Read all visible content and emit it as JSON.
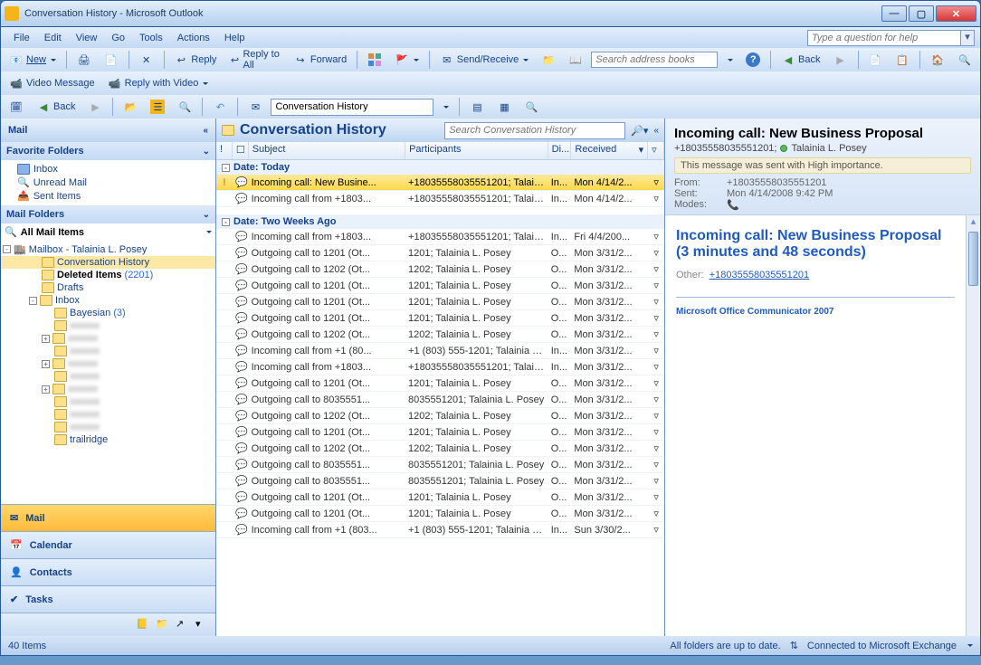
{
  "window": {
    "title": "Conversation History - Microsoft Outlook"
  },
  "menu": [
    "File",
    "Edit",
    "View",
    "Go",
    "Tools",
    "Actions",
    "Help"
  ],
  "ask_placeholder": "Type a question for help",
  "tb1": {
    "new": "New",
    "reply": "Reply",
    "reply_all": "Reply to All",
    "forward": "Forward",
    "send_recv": "Send/Receive",
    "search_books_ph": "Search address books",
    "back": "Back"
  },
  "tb2": {
    "video_msg": "Video Message",
    "reply_video": "Reply with Video"
  },
  "tb3": {
    "back": "Back",
    "folder_combo": "Conversation History"
  },
  "nav": {
    "title": "Mail",
    "fav_header": "Favorite Folders",
    "favs": [
      "Inbox",
      "Unread Mail",
      "Sent Items"
    ],
    "mail_folders_header": "Mail Folders",
    "all_mail": "All Mail Items",
    "mailbox": "Mailbox - Talainia L. Posey",
    "tree": [
      {
        "n": "Conversation History",
        "d": 1,
        "sel": true
      },
      {
        "n": "Deleted Items",
        "d": 1,
        "bold": true,
        "count": "(2201)"
      },
      {
        "n": "Drafts",
        "d": 1
      },
      {
        "n": "Inbox",
        "d": 1,
        "exp": "-"
      },
      {
        "n": "Bayesian",
        "d": 2,
        "count": "(3)"
      },
      {
        "n": "",
        "d": 2,
        "blur": true
      },
      {
        "n": "",
        "d": 2,
        "blur": true,
        "exp": "+"
      },
      {
        "n": "",
        "d": 2,
        "blur": true
      },
      {
        "n": "",
        "d": 2,
        "blur": true,
        "exp": "+"
      },
      {
        "n": "",
        "d": 2,
        "blur": true
      },
      {
        "n": "",
        "d": 2,
        "blur": true,
        "exp": "+"
      },
      {
        "n": "",
        "d": 2,
        "blur": true
      },
      {
        "n": "",
        "d": 2,
        "blur": true
      },
      {
        "n": "",
        "d": 2,
        "blur": true
      },
      {
        "n": "trailridge",
        "d": 2,
        "blur": false
      }
    ],
    "bigs": [
      {
        "name": "Mail",
        "active": true
      },
      {
        "name": "Calendar"
      },
      {
        "name": "Contacts"
      },
      {
        "name": "Tasks"
      }
    ]
  },
  "list": {
    "title": "Conversation History",
    "search_ph": "Search Conversation History",
    "cols": {
      "subject": "Subject",
      "participants": "Participants",
      "di": "Di...",
      "received": "Received"
    },
    "groups": [
      {
        "label": "Date: Today",
        "rows": [
          {
            "imp": true,
            "s": "Incoming call: New Busine...",
            "p": "+18035558035551201; Talaini...",
            "d": "In...",
            "r": "Mon 4/14/2...",
            "sel": true
          },
          {
            "s": "Incoming call from +1803...",
            "p": "+18035558035551201; Talaini...",
            "d": "In...",
            "r": "Mon 4/14/2..."
          }
        ]
      },
      {
        "label": "Date: Two Weeks Ago",
        "rows": [
          {
            "s": "Incoming call from +1803...",
            "p": "+18035558035551201; Talaini...",
            "d": "In...",
            "r": "Fri 4/4/200..."
          },
          {
            "s": "Outgoing call to 1201 (Ot...",
            "p": "1201; Talainia L. Posey",
            "d": "O...",
            "r": "Mon 3/31/2..."
          },
          {
            "s": "Outgoing call to 1202 (Ot...",
            "p": "1202; Talainia L. Posey",
            "d": "O...",
            "r": "Mon 3/31/2..."
          },
          {
            "s": "Outgoing call to 1201 (Ot...",
            "p": "1201; Talainia L. Posey",
            "d": "O...",
            "r": "Mon 3/31/2..."
          },
          {
            "s": "Outgoing call to 1201 (Ot...",
            "p": "1201; Talainia L. Posey",
            "d": "O...",
            "r": "Mon 3/31/2..."
          },
          {
            "s": "Outgoing call to 1201 (Ot...",
            "p": "1201; Talainia L. Posey",
            "d": "O...",
            "r": "Mon 3/31/2..."
          },
          {
            "s": "Outgoing call to 1202 (Ot...",
            "p": "1202; Talainia L. Posey",
            "d": "O...",
            "r": "Mon 3/31/2..."
          },
          {
            "s": "Incoming call from +1 (80...",
            "p": "+1 (803) 555-1201; Talainia L...",
            "d": "In...",
            "r": "Mon 3/31/2..."
          },
          {
            "s": "Incoming call from +1803...",
            "p": "+18035558035551201; Talaini...",
            "d": "In...",
            "r": "Mon 3/31/2..."
          },
          {
            "s": "Outgoing call to 1201 (Ot...",
            "p": "1201; Talainia L. Posey",
            "d": "O...",
            "r": "Mon 3/31/2..."
          },
          {
            "s": "Outgoing call to 8035551...",
            "p": "8035551201; Talainia L. Posey",
            "d": "O...",
            "r": "Mon 3/31/2..."
          },
          {
            "s": "Outgoing call to 1202 (Ot...",
            "p": "1202; Talainia L. Posey",
            "d": "O...",
            "r": "Mon 3/31/2..."
          },
          {
            "s": "Outgoing call to 1201 (Ot...",
            "p": "1201; Talainia L. Posey",
            "d": "O...",
            "r": "Mon 3/31/2..."
          },
          {
            "s": "Outgoing call to 1202 (Ot...",
            "p": "1202; Talainia L. Posey",
            "d": "O...",
            "r": "Mon 3/31/2..."
          },
          {
            "s": "Outgoing call to 8035551...",
            "p": "8035551201; Talainia L. Posey",
            "d": "O...",
            "r": "Mon 3/31/2..."
          },
          {
            "s": "Outgoing call to 8035551...",
            "p": "8035551201; Talainia L. Posey",
            "d": "O...",
            "r": "Mon 3/31/2..."
          },
          {
            "s": "Outgoing call to 1201 (Ot...",
            "p": "1201; Talainia L. Posey",
            "d": "O...",
            "r": "Mon 3/31/2..."
          },
          {
            "s": "Outgoing call to 1201 (Ot...",
            "p": "1201; Talainia L. Posey",
            "d": "O...",
            "r": "Mon 3/31/2..."
          },
          {
            "s": "Incoming call from +1 (803...",
            "p": "+1 (803) 555-1201; Talainia L...",
            "d": "In...",
            "r": "Sun 3/30/2..."
          }
        ]
      }
    ]
  },
  "reading": {
    "subject": "Incoming call: New Business Proposal",
    "from_num": "+18035558035551201;",
    "from_name": "Talainia L. Posey",
    "importance": "This message was sent with High importance.",
    "from_lbl": "From:",
    "sent_lbl": "Sent:",
    "modes_lbl": "Modes:",
    "from_val": "+18035558035551201",
    "sent_val": "Mon 4/14/2008 9:42 PM",
    "body_title": "Incoming call: New Business Proposal (3 minutes and 48 seconds)",
    "other_lbl": "Other:",
    "other_link": "+18035558035551201",
    "footer": "Microsoft Office Communicator 2007"
  },
  "status": {
    "items": "40 Items",
    "sync": "All folders are up to date.",
    "conn": "Connected to Microsoft Exchange"
  }
}
